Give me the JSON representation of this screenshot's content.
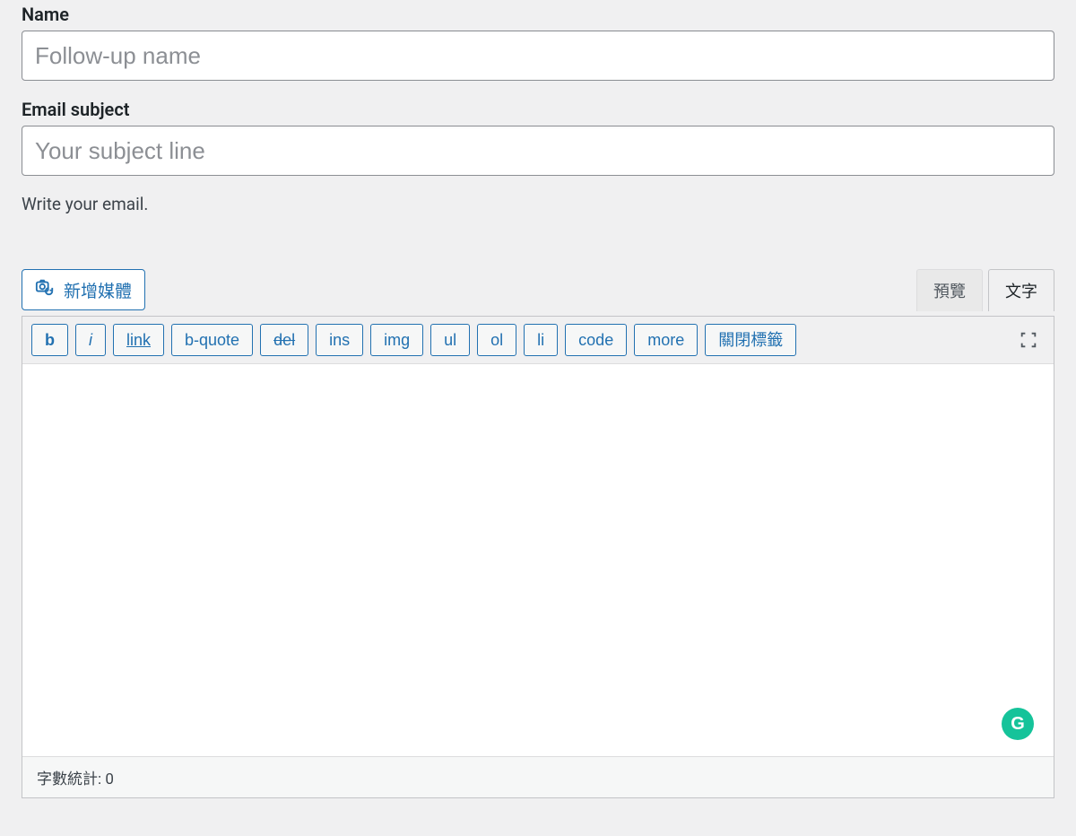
{
  "fields": {
    "name_label": "Name",
    "name_placeholder": "Follow-up name",
    "email_subject_label": "Email subject",
    "email_subject_placeholder": "Your subject line",
    "help_text": "Write your email."
  },
  "media_button": {
    "label": "新增媒體"
  },
  "tabs": {
    "preview": "預覽",
    "text": "文字"
  },
  "toolbar": {
    "b": "b",
    "i": "i",
    "link": "link",
    "bquote": "b-quote",
    "del": "del",
    "ins": "ins",
    "img": "img",
    "ul": "ul",
    "ol": "ol",
    "li": "li",
    "code": "code",
    "more": "more",
    "close_tags": "關閉標籤"
  },
  "status": {
    "word_count_label": "字數統計: ",
    "word_count_value": "0"
  },
  "grammarly": {
    "initial": "G"
  }
}
